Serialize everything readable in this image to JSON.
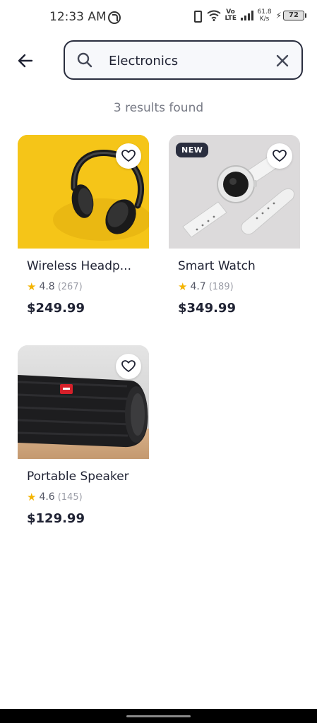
{
  "status_bar": {
    "time": "12:33 AM",
    "network_type": "Vo\nLTE",
    "speed_value": "61.8",
    "speed_unit": "K/s",
    "battery": "72"
  },
  "header": {
    "search_value": "Electronics",
    "icons": [
      "arrow-left-icon",
      "search-icon",
      "close-icon"
    ]
  },
  "results_text": "3 results found",
  "colors": {
    "primary_dark": "#2a2e3f",
    "star": "#f4b400",
    "headphones_bg": "#f5c518"
  },
  "products": [
    {
      "title": "Wireless Headp...",
      "rating": "4.8",
      "reviews": "(267)",
      "price": "$249.99",
      "badge": ""
    },
    {
      "title": "Smart Watch",
      "rating": "4.7",
      "reviews": "(189)",
      "price": "$349.99",
      "badge": "NEW"
    },
    {
      "title": "Portable Speaker",
      "rating": "4.6",
      "reviews": "(145)",
      "price": "$129.99",
      "badge": ""
    }
  ]
}
